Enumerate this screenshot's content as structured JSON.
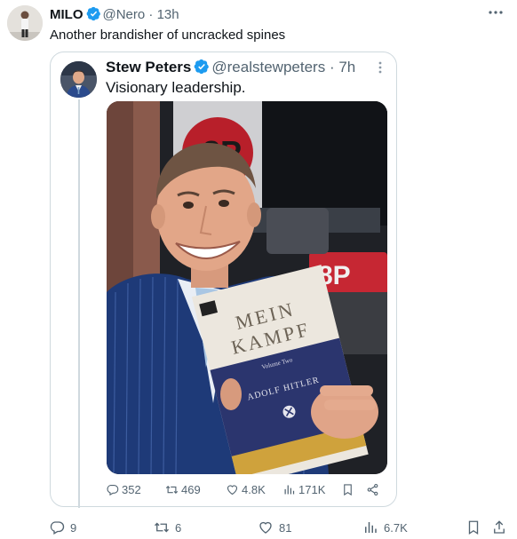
{
  "tweet": {
    "author_name": "MILO",
    "author_handle": "@Nero",
    "separator": "·",
    "time": "13h",
    "text": "Another brandisher of uncracked spines",
    "actions": {
      "replies": "9",
      "reposts": "6",
      "likes": "81",
      "views": "6.7K"
    }
  },
  "quoted": {
    "author_name": "Stew Peters",
    "author_handle": "@realstewpeters",
    "separator": "·",
    "time": "7h",
    "text": "Visionary leadership.",
    "photo": {
      "book_title_line1": "MEIN",
      "book_title_line2": "KAMPF",
      "book_volume": "Volume Two",
      "book_author": "ADOLF HITLER",
      "badge": "8P"
    },
    "actions": {
      "replies": "352",
      "reposts": "469",
      "likes": "4.8K",
      "views": "171K"
    }
  },
  "colors": {
    "verified": "#1d9bf0",
    "muted": "#536471",
    "border": "#cfd9de"
  }
}
